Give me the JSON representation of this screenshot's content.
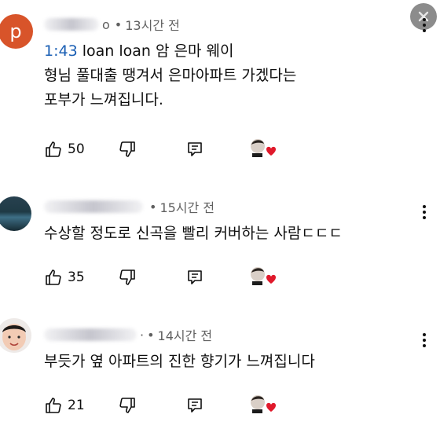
{
  "comments": [
    {
      "avatar_letter": "p",
      "author_visible": "o",
      "time": "13시간 전",
      "timestamp_link": "1:43",
      "line1_rest": " loan loan 암 은마 웨이",
      "line2": "형님 풀대출 땡겨서 은마아파트 가겠다는",
      "line3": "포부가 느껴집니다.",
      "likes": "50"
    },
    {
      "time": "15시간 전",
      "line1": "수상할 정도로 신곡을 빨리 커버하는 사람ㄷㄷㄷ",
      "likes": "35"
    },
    {
      "author_visible": "·",
      "time": "14시간 전",
      "line1": "부듯가 옆 아파트의 진한 향기가 느껴집니다",
      "likes": "21"
    }
  ],
  "colors": {
    "heart": "#e0192b",
    "timestamp": "#1a5fb4",
    "meta": "#606060",
    "avatar_p": "#d8542a"
  },
  "icons": [
    "like-icon",
    "dislike-icon",
    "reply-icon",
    "creator-heart-icon",
    "more-vert-icon",
    "close-icon"
  ]
}
